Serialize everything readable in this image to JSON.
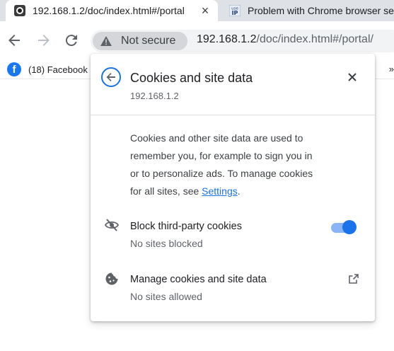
{
  "tabs": [
    {
      "title": "192.168.1.2/doc/index.html#/portal",
      "icon": "camera-favicon-icon",
      "close": "×"
    },
    {
      "title": "Problem with Chrome browser set",
      "icon": "useip-favicon-icon",
      "badge_top": "use",
      "badge_bottom": "IP"
    }
  ],
  "toolbar": {
    "security_label": "Not secure",
    "url_host": "192.168.1.2",
    "url_path": "/doc/index.html#/portal/"
  },
  "bookmarks": [
    {
      "label": "(18) Facebook",
      "icon_letter": "f"
    }
  ],
  "bookmarks_overflow": "»",
  "popup": {
    "title": "Cookies and site data",
    "subtitle": "192.168.1.2",
    "description_line1": "Cookies and other site data are used to",
    "description_line2": "remember you, for example to sign you in",
    "description_line3": "or to personalize ads. To manage cookies",
    "description_line4_prefix": "for all sites, see ",
    "settings_link": "Settings",
    "description_line4_suffix": ".",
    "block_title": "Block third-party cookies",
    "block_sub": "No sites blocked",
    "block_enabled": true,
    "manage_title": "Manage cookies and site data",
    "manage_sub": "No sites allowed"
  },
  "colors": {
    "accent": "#1a73e8",
    "toggle_track": "#8ab4f8"
  }
}
